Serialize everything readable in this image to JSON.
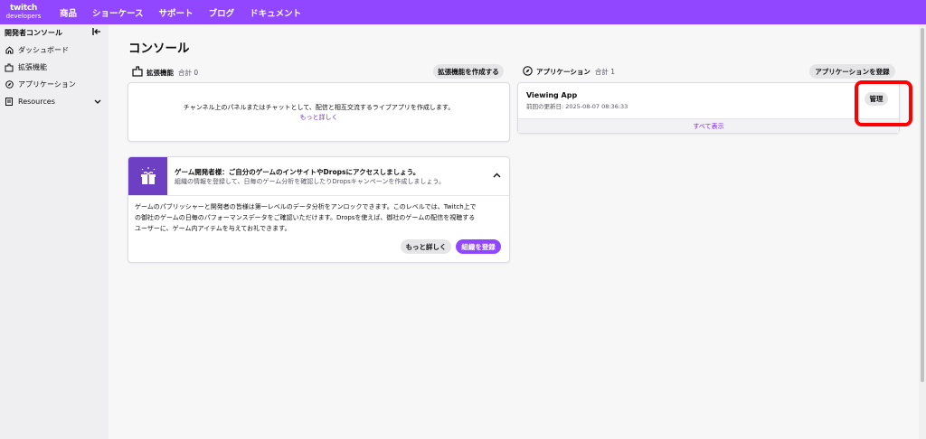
{
  "topbar": {
    "logo_line1": "twitch",
    "logo_line2": "developers",
    "nav": [
      "商品",
      "ショーケース",
      "サポート",
      "ブログ",
      "ドキュメント"
    ]
  },
  "sidebar": {
    "title": "開発者コンソール",
    "collapse_icon": "collapse-left-icon",
    "items": [
      {
        "label": "ダッシュボード",
        "icon": "home-icon"
      },
      {
        "label": "拡張機能",
        "icon": "extensions-icon"
      },
      {
        "label": "アプリケーション",
        "icon": "compass-icon"
      },
      {
        "label": "Resources",
        "icon": "document-icon"
      }
    ]
  },
  "page_title": "コンソール",
  "extensions": {
    "title": "拡張機能",
    "count": "合計 0",
    "create_button": "拡張機能を作成する",
    "empty_text": "チャンネル上のパネルまたはチャットとして、配信と相互交流するライブアプリを作成します。",
    "learn_more": "もっと詳しく"
  },
  "applications": {
    "title": "アプリケーション",
    "count": "合計 1",
    "register_button": "アプリケーションを登録",
    "app_name": "Viewing App",
    "app_updated": "前回の更新日: 2025-08-07 08:36:33",
    "manage_button": "管理",
    "view_all": "すべて表示"
  },
  "promo": {
    "title": "ゲーム開発者様：ご自分のゲームのインサイトやDropsにアクセスしましょう。",
    "subtitle": "組織の情報を登録して、日毎のゲーム分析を確認したりDropsキャンペーンを作成しましょう。",
    "body_lines": [
      "ゲームのパブリッシャーと開発者の皆様は第一レベルのデータ分析をアンロックできます。このレベルでは、Twitch上で",
      "の御社のゲームの日毎のパフォーマンスデータをご確認いただけます。Dropsを使えば、御社のゲームの配信を視聴する",
      "ユーザーに、ゲーム内アイテムを与えてお礼できます。"
    ],
    "learn_more_button": "もっと詳しく",
    "register_org_button": "組織を登録"
  },
  "colors": {
    "brand": "#9147ff",
    "highlight": "#ff0000"
  }
}
